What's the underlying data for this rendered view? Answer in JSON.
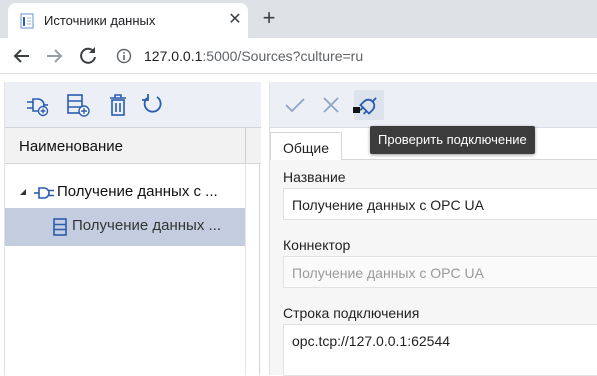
{
  "browser": {
    "tab_title": "Источники данных",
    "tab_close": "✕",
    "new_tab": "+",
    "url_host": "127.0.0.1",
    "url_rest": ":5000/Sources?culture=ru"
  },
  "left": {
    "toolbar": [
      "add-connector",
      "add-source",
      "delete",
      "refresh"
    ],
    "column_header": "Наименование",
    "tree": [
      {
        "label": "Получение данных с ...",
        "icon": "plug-icon",
        "expanded": true
      },
      {
        "label": "Получение данных ...",
        "icon": "source-icon",
        "selected": true
      }
    ]
  },
  "right": {
    "toolbar": [
      "apply",
      "cancel",
      "test-connection"
    ],
    "tab": "Общие",
    "fields": {
      "name_label": "Название",
      "name_value": "Получение данных с OPC UA",
      "connector_label": "Коннектор",
      "connector_value": "Получение данных с OPC UA",
      "conn_label": "Строка подключения",
      "conn_value": "opc.tcp://127.0.0.1:62544"
    },
    "tooltip": "Проверить подключение"
  },
  "colors": {
    "accent": "#2a5db0",
    "selection": "#c4cde0",
    "toolbar_bg": "#ecf0f6"
  }
}
